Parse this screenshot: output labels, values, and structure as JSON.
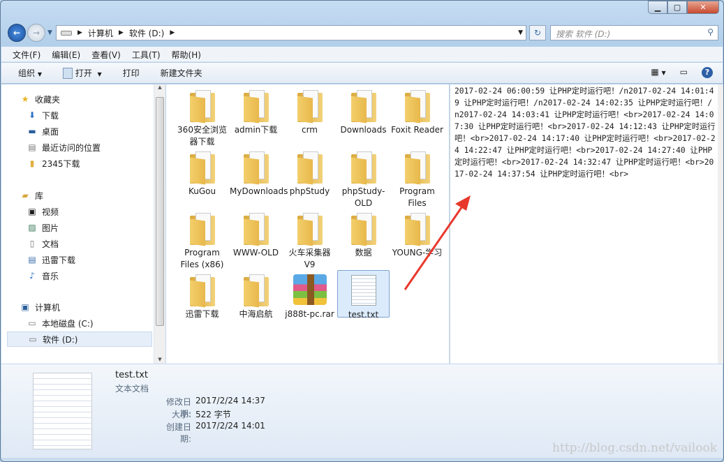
{
  "window": {
    "controls": [
      "minimize",
      "maximize",
      "close"
    ]
  },
  "nav": {
    "back": "back-icon",
    "forward": "forward-icon"
  },
  "address": {
    "crumbs": [
      "计算机",
      "软件 (D:)"
    ]
  },
  "search": {
    "placeholder": "搜索 软件 (D:)"
  },
  "menu": [
    "文件(F)",
    "编辑(E)",
    "查看(V)",
    "工具(T)",
    "帮助(H)"
  ],
  "toolbar": {
    "organize": "组织",
    "open": "打开",
    "print": "打印",
    "new_folder": "新建文件夹"
  },
  "sidebar": {
    "favorites": {
      "label": "收藏夹",
      "items": [
        "下载",
        "桌面",
        "最近访问的位置",
        "2345下载"
      ]
    },
    "libraries": {
      "label": "库",
      "items": [
        "视频",
        "图片",
        "文档",
        "迅雷下载",
        "音乐"
      ]
    },
    "computer": {
      "label": "计算机",
      "items": [
        "本地磁盘 (C:)",
        "软件 (D:)"
      ]
    }
  },
  "files": [
    {
      "name": "360安全浏览器下载",
      "type": "folder"
    },
    {
      "name": "admin下载",
      "type": "folder"
    },
    {
      "name": "crm",
      "type": "folder"
    },
    {
      "name": "Downloads",
      "type": "folder"
    },
    {
      "name": "Foxit Reader",
      "type": "folder"
    },
    {
      "name": "KuGou",
      "type": "folder"
    },
    {
      "name": "MyDownloads",
      "type": "folder"
    },
    {
      "name": "phpStudy",
      "type": "folder"
    },
    {
      "name": "phpStudy-OLD",
      "type": "folder"
    },
    {
      "name": "Program Files",
      "type": "folder"
    },
    {
      "name": "Program Files (x86)",
      "type": "folder"
    },
    {
      "name": "WWW-OLD",
      "type": "folder"
    },
    {
      "name": "火车采集器V9",
      "type": "folder"
    },
    {
      "name": "数据",
      "type": "folder"
    },
    {
      "name": "YOUNG-学习",
      "type": "folder"
    },
    {
      "name": "迅雷下载",
      "type": "folder"
    },
    {
      "name": "中海启航",
      "type": "folder"
    },
    {
      "name": "j888t-pc.rar",
      "type": "rar"
    },
    {
      "name": "test.txt",
      "type": "txt",
      "selected": true
    }
  ],
  "preview": {
    "text": "2017-02-24 06:00:59 让PHP定时运行吧！/n2017-02-24 14:01:49 让PHP定时运行吧！/n2017-02-24 14:02:35 让PHP定时运行吧！/n2017-02-24 14:03:41 让PHP定时运行吧！<br>2017-02-24 14:07:30 让PHP定时运行吧！<br>2017-02-24 14:12:43 让PHP定时运行吧！<br>2017-02-24 14:17:40 让PHP定时运行吧！<br>2017-02-24 14:22:47 让PHP定时运行吧！<br>2017-02-24 14:27:40 让PHP定时运行吧！<br>2017-02-24 14:32:47 让PHP定时运行吧！<br>2017-02-24 14:37:54 让PHP定时运行吧！<br>"
  },
  "details": {
    "name": "test.txt",
    "type": "文本文档",
    "modified_label": "修改日期:",
    "modified": "2017/2/24 14:37",
    "size_label": "大小:",
    "size": "522 字节",
    "created_label": "创建日期:",
    "created": "2017/2/24 14:01"
  },
  "watermark": "http://blog.csdn.net/vailook",
  "colors": {
    "annotation_arrow": "#e8382c",
    "selection": "#dcebfc"
  }
}
